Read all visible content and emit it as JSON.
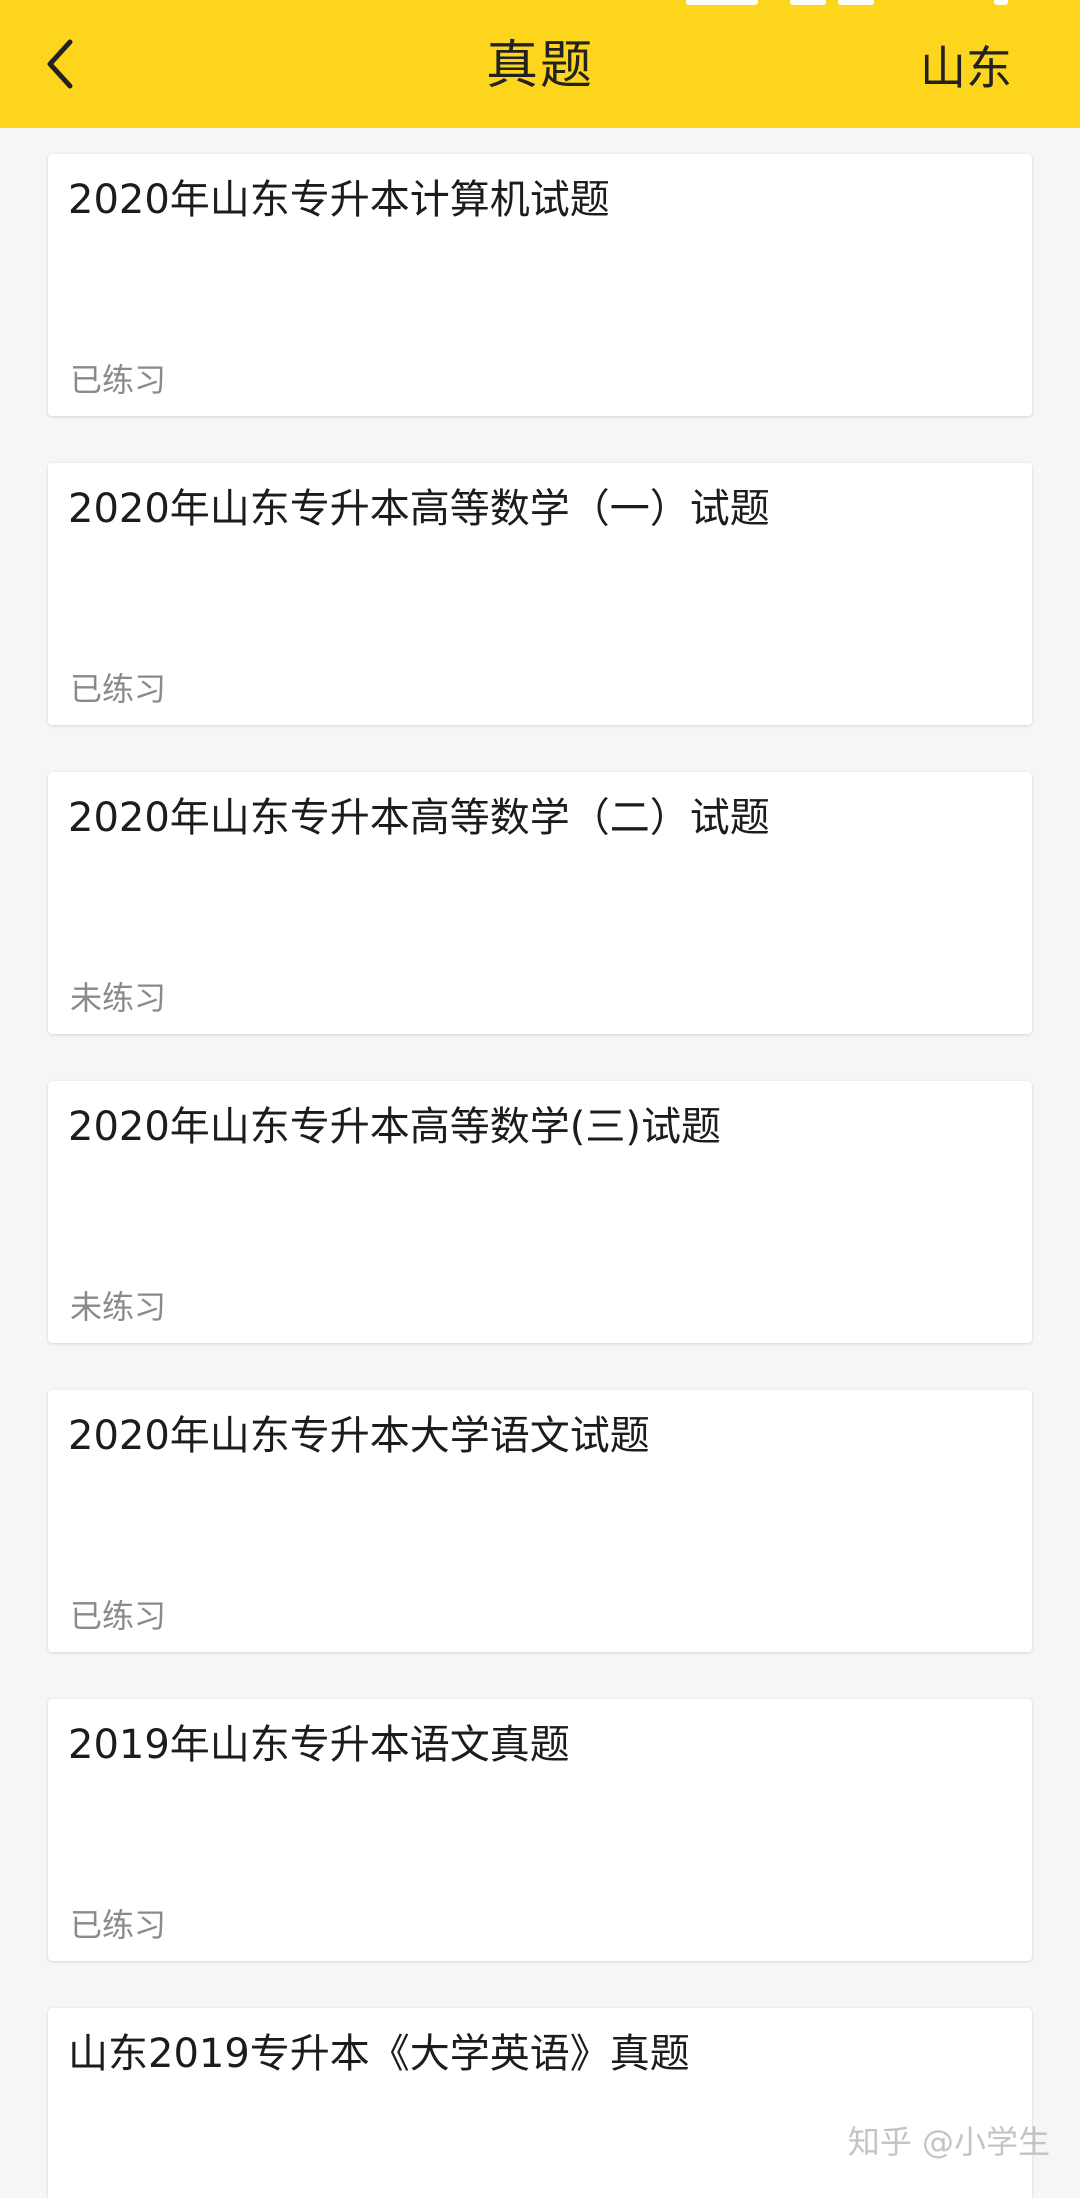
{
  "header": {
    "title": "真题",
    "region": "山东",
    "back_icon": "chevron-left-icon"
  },
  "papers": [
    {
      "title": "2020年山东专升本计算机试题",
      "status": "已练习"
    },
    {
      "title": "2020年山东专升本高等数学（一）试题",
      "status": "已练习"
    },
    {
      "title": "2020年山东专升本高等数学（二）试题",
      "status": "未练习"
    },
    {
      "title": "2020年山东专升本高等数学(三)试题",
      "status": "未练习"
    },
    {
      "title": "2020年山东专升本大学语文试题",
      "status": "已练习"
    },
    {
      "title": "2019年山东专升本语文真题",
      "status": "已练习"
    },
    {
      "title": "山东2019专升本《大学英语》真题",
      "status": ""
    }
  ],
  "watermark": "知乎 @小学生",
  "colors": {
    "header_bg": "#fdd51c",
    "page_bg": "#f6f6f6",
    "card_bg": "#ffffff",
    "status_text": "#8a8a8a"
  }
}
